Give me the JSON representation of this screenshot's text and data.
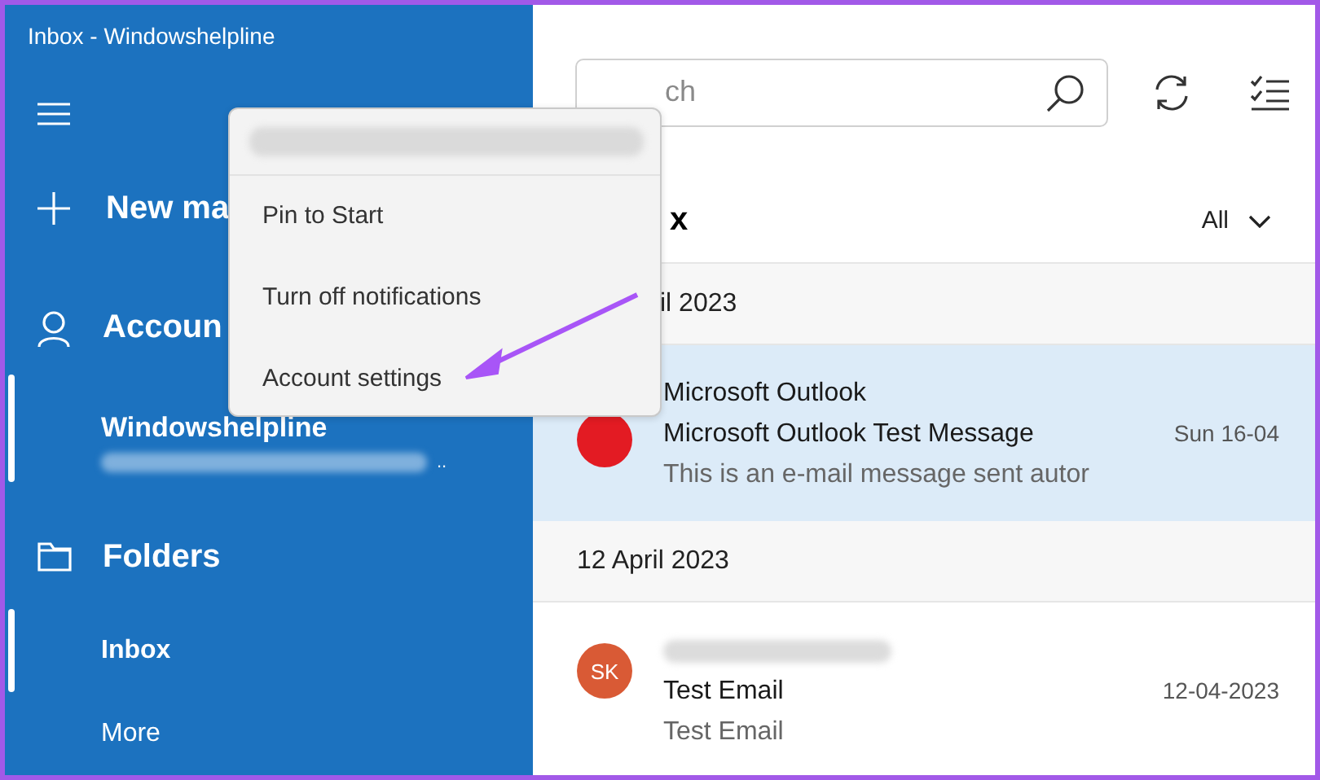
{
  "window": {
    "title": "Inbox - Windowshelpline"
  },
  "sidebar": {
    "new_mail": "New ma",
    "accounts": {
      "label": "Accoun",
      "items": [
        {
          "name": "Windowshelpline",
          "address_tail": "..",
          "selected": true
        }
      ]
    },
    "folders": {
      "label": "Folders",
      "items": [
        {
          "name": "Inbox",
          "selected": true
        },
        {
          "name": "More",
          "selected": false
        }
      ]
    }
  },
  "context_menu": {
    "items": [
      "Pin to Start",
      "Turn off notifications",
      "Account settings"
    ]
  },
  "search": {
    "placeholder": "ch"
  },
  "list_heading": "x",
  "filter": "All",
  "groups": [
    {
      "date": "il 2023",
      "messages": [
        {
          "sender": "Microsoft Outlook",
          "subject": "Microsoft Outlook Test Message",
          "preview": "This is an e-mail message sent autor",
          "time": "Sun 16-04",
          "selected": true,
          "color": "#e31b23"
        }
      ]
    },
    {
      "date": "12 April 2023",
      "messages": [
        {
          "initials": "SK",
          "subject": "Test Email",
          "preview": "Test Email",
          "time": "12-04-2023",
          "selected": false,
          "color": "#d95a35"
        }
      ]
    }
  ]
}
